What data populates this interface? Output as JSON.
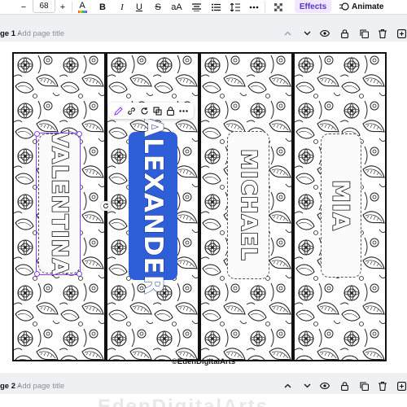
{
  "toolbar": {
    "minus": "−",
    "font_size": "68",
    "plus": "+",
    "text_color": "A",
    "bold": "B",
    "italic": "I",
    "underline": "U",
    "strike": "S",
    "case": "aA",
    "effects": "Effects",
    "animate": "Animate"
  },
  "page1": {
    "label": "ge 1",
    "separator": " - ",
    "title_placeholder": "Add page title"
  },
  "page2": {
    "label": "ge 2",
    "separator": " - ",
    "title_placeholder": "Add page title",
    "ghost_text": "EdenDigitalArts"
  },
  "bookmarks": [
    {
      "name": "VALENTINA",
      "style": "outline"
    },
    {
      "name": "ALEXANDER",
      "style": "blue"
    },
    {
      "name": "MICHAEL",
      "style": "outline"
    },
    {
      "name": "MIA",
      "style": "outline"
    }
  ],
  "copyright": "©EdenDigitalArts",
  "colors": {
    "accent": "#8b3dff",
    "effects_bg": "#f1e8ff",
    "blue_fill": "#2e5fd8"
  },
  "icons": [
    "text-color-icon",
    "align-icon",
    "list-icon",
    "spacing-icon",
    "transparency-icon",
    "animate-icon",
    "chevron-up-icon",
    "chevron-down-icon",
    "eye-icon",
    "lock-icon",
    "copy-icon",
    "trash-icon",
    "add-page-icon",
    "edit-icon",
    "link-icon",
    "rotate-icon",
    "group-icon",
    "more-icon"
  ]
}
